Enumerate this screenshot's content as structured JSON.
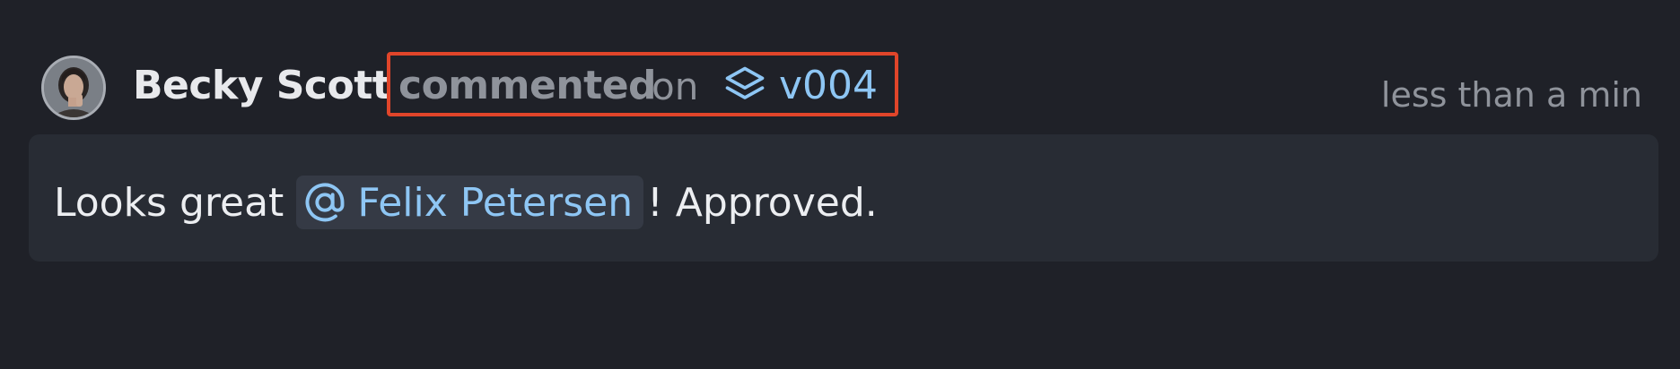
{
  "activity": {
    "author": "Becky Scott",
    "action": "commented",
    "connector": "on",
    "version": "v004",
    "timestamp": "less than a min",
    "comment": {
      "prefix": "Looks great",
      "mention": "Felix Petersen",
      "suffix": "! Approved."
    }
  },
  "colors": {
    "background": "#1f2128",
    "comment_background": "#282c34",
    "link": "#8ec6f4",
    "highlight_border": "#e0452a",
    "muted_text": "#8f939b"
  },
  "icons": {
    "version": "layers-icon",
    "mention": "at-sign-icon"
  }
}
